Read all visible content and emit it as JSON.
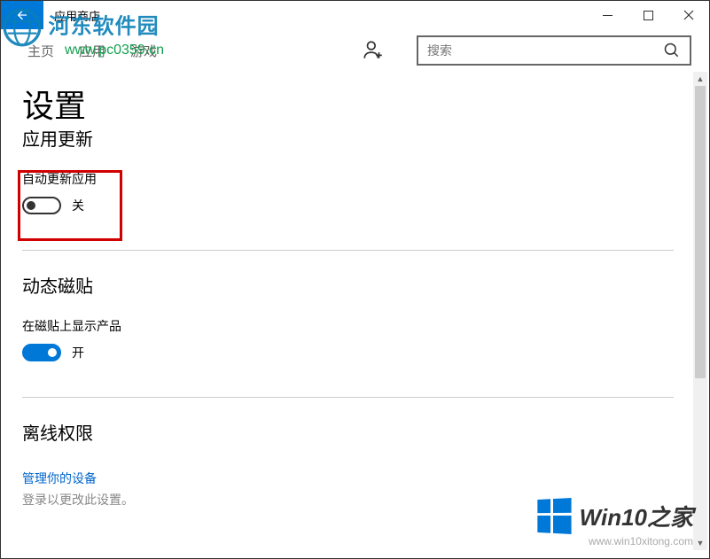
{
  "window": {
    "title": "应用商店"
  },
  "nav": {
    "home": "主页",
    "apps": "应用",
    "games": "游戏"
  },
  "search": {
    "placeholder": "搜索"
  },
  "page": {
    "title": "设置"
  },
  "sections": {
    "updates": {
      "heading": "应用更新",
      "auto_update_label": "自动更新应用",
      "auto_update_state": "关"
    },
    "live_tiles": {
      "heading": "动态磁贴",
      "show_products_label": "在磁贴上显示产品",
      "show_products_state": "开"
    },
    "offline": {
      "heading": "离线权限",
      "manage_link": "管理你的设备",
      "signin_text": "登录以更改此设置。"
    }
  },
  "watermarks": {
    "logo_text": "河东软件园",
    "logo_url": "www.pc0359.cn",
    "brand_text": "Win10之家",
    "brand_url": "www.win10xitong.com"
  }
}
